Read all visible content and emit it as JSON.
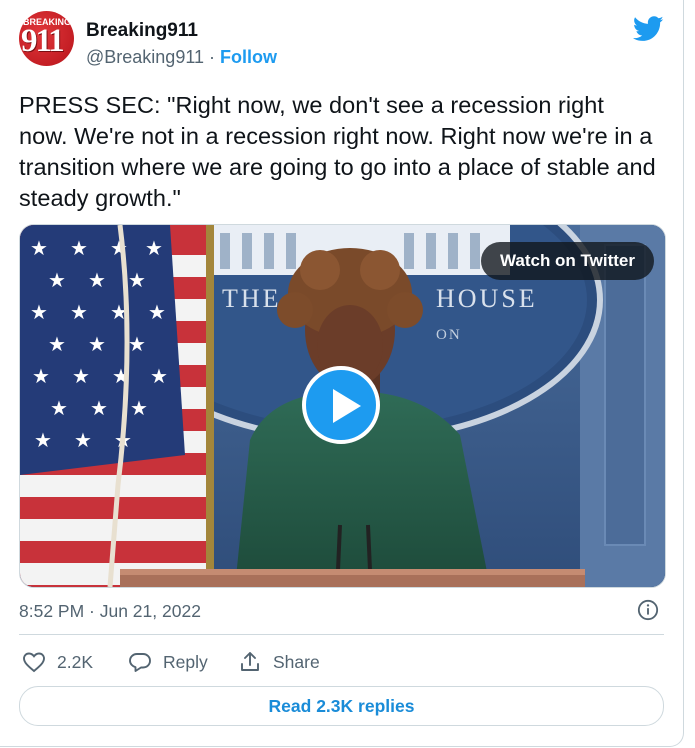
{
  "author": {
    "display_name": "Breaking911",
    "handle": "@Breaking911",
    "separator": "·",
    "follow_label": "Follow",
    "avatar_text_small": "BREAKING",
    "avatar_text_big": "911"
  },
  "tweet": {
    "text": "PRESS SEC: \"Right now, we don't see a recession right now. We're not in a recession right now. Right now we're in a transition where we are going to go into a place of stable and steady growth.\"",
    "timestamp": "8:52 PM · Jun 21, 2022"
  },
  "media": {
    "watch_label": "Watch on Twitter",
    "backdrop_text_left": "THE",
    "backdrop_text_right": "HOUSE",
    "backdrop_text_small": "ON"
  },
  "actions": {
    "like_count": "2.2K",
    "reply_label": "Reply",
    "share_label": "Share"
  },
  "read_replies_label": "Read 2.3K replies",
  "colors": {
    "accent": "#1d9bf0",
    "text": "#0f1419",
    "secondary": "#536471",
    "border": "#cfd9de",
    "avatar": "#c41e24"
  },
  "icons": {
    "brand": "twitter-bird-icon",
    "play": "play-icon",
    "info": "info-icon",
    "like": "heart-icon",
    "reply": "reply-bubble-icon",
    "share": "share-upload-icon"
  }
}
